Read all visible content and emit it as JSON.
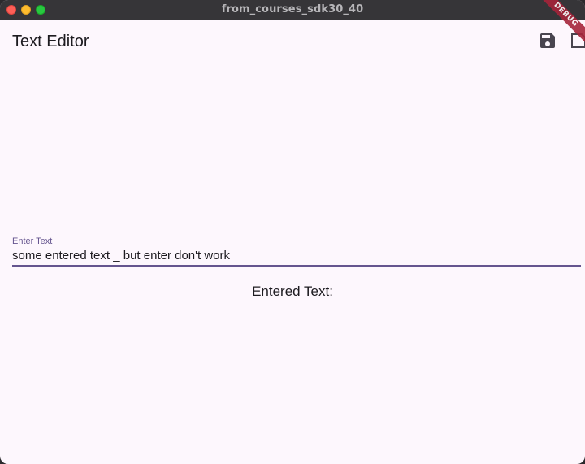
{
  "window": {
    "title": "from_courses_sdk30_40"
  },
  "appbar": {
    "title": "Text Editor",
    "actions": [
      {
        "icon": "save-icon"
      },
      {
        "icon": "document-icon"
      }
    ]
  },
  "debug_banner": {
    "label": "DEBUG"
  },
  "text_field": {
    "label": "Enter Text",
    "value": "some entered text _ but enter don't work"
  },
  "output": {
    "label": "Entered Text:"
  },
  "colors": {
    "background": "#fdf7fd",
    "accent": "#65558f",
    "text": "#1d1b20",
    "titlebar": "#363538",
    "debug": "#a6243a"
  }
}
